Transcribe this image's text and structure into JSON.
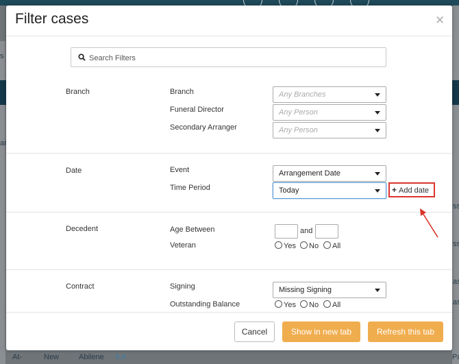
{
  "background": {
    "left_snippet": "s",
    "left_snippet2": "ar",
    "right_snippets": [
      "ss",
      "sse",
      "ase",
      "asse",
      "Pass"
    ],
    "bottom_row": [
      "At-",
      "New",
      "Abilene",
      "4.4"
    ]
  },
  "modal": {
    "title": "Filter cases",
    "search": {
      "placeholder": "Search Filters",
      "value": ""
    },
    "sections": {
      "branch": {
        "label": "Branch",
        "fields": [
          {
            "label": "Branch",
            "placeholder": "Any Branches"
          },
          {
            "label": "Funeral Director",
            "placeholder": "Any Person"
          },
          {
            "label": "Secondary Arranger",
            "placeholder": "Any Person"
          }
        ]
      },
      "date": {
        "label": "Date",
        "event_label": "Event",
        "event_value": "Arrangement Date",
        "period_label": "Time Period",
        "period_value": "Today",
        "add_date_label": "Add date"
      },
      "decedent": {
        "label": "Decedent",
        "age_label": "Age Between",
        "and_label": "and",
        "veteran_label": "Veteran",
        "veteran_options": [
          "Yes",
          "No",
          "All"
        ]
      },
      "contract": {
        "label": "Contract",
        "signing_label": "Signing",
        "signing_value": "Missing Signing",
        "balance_label": "Outstanding Balance",
        "balance_options": [
          "Yes",
          "No",
          "All"
        ]
      }
    },
    "buttons": {
      "cancel": "Cancel",
      "new_tab": "Show in new tab",
      "refresh": "Refresh this tab"
    }
  },
  "colors": {
    "accent_orange": "#f0ad4e",
    "highlight_red": "#d9342b",
    "header_dark": "#15384a"
  }
}
